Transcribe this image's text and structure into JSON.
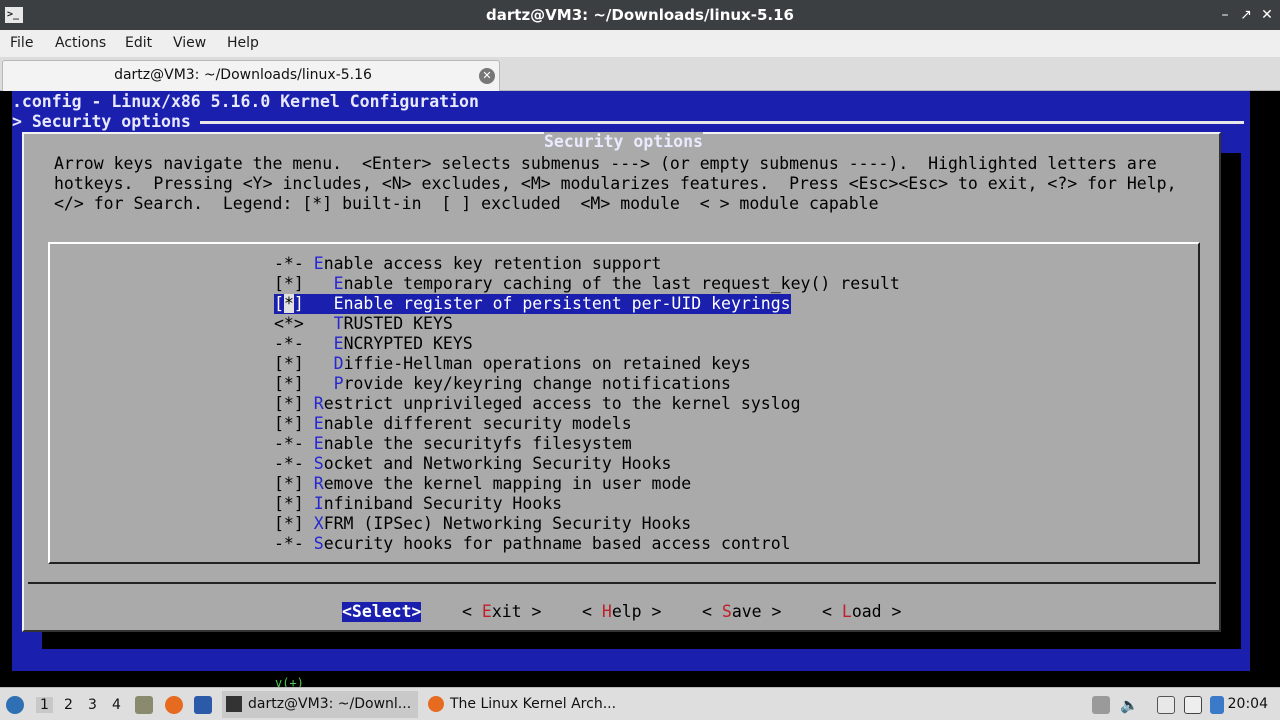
{
  "window": {
    "title": "dartz@VM3: ~/Downloads/linux-5.16",
    "app_icon": ">_"
  },
  "menubar": {
    "items": [
      "File",
      "Actions",
      "Edit",
      "View",
      "Help"
    ]
  },
  "tab": {
    "label": "dartz@VM3: ~/Downloads/linux-5.16"
  },
  "terminal": {
    "header_line1": ".config - Linux/x86 5.16.0 Kernel Configuration",
    "header_line2": "> Security options",
    "dialog_title": "Security options",
    "help_lines": [
      "Arrow keys navigate the menu.  <Enter> selects submenus ---> (or empty submenus ----).  Highlighted letters are",
      "hotkeys.  Pressing <Y> includes, <N> excludes, <M> modularizes features.  Press <Esc><Esc> to exit, <?> for Help,",
      "</> for Search.  Legend: [*] built-in  [ ] excluded  <M> module  < > module capable"
    ],
    "menu_items": [
      {
        "state": "-*-",
        "indent": "",
        "hotkey": "E",
        "rest": "nable access key retention support"
      },
      {
        "state": "[*]",
        "indent": "  ",
        "hotkey": "E",
        "rest": "nable temporary caching of the last request_key() result"
      },
      {
        "state": "[*]",
        "indent": "  ",
        "hotkey": "E",
        "rest": "nable register of persistent per-UID keyrings",
        "selected": true
      },
      {
        "state": "<*>",
        "indent": "  ",
        "hotkey": "T",
        "rest": "RUSTED KEYS"
      },
      {
        "state": "-*-",
        "indent": "  ",
        "hotkey": "E",
        "rest": "NCRYPTED KEYS"
      },
      {
        "state": "[*]",
        "indent": "  ",
        "hotkey": "D",
        "rest": "iffie-Hellman operations on retained keys"
      },
      {
        "state": "[*]",
        "indent": "  ",
        "hotkey": "P",
        "rest": "rovide key/keyring change notifications"
      },
      {
        "state": "[*]",
        "indent": "",
        "hotkey": "R",
        "rest": "estrict unprivileged access to the kernel syslog"
      },
      {
        "state": "[*]",
        "indent": "",
        "hotkey": "E",
        "rest": "nable different security models"
      },
      {
        "state": "-*-",
        "indent": "",
        "hotkey": "E",
        "rest": "nable the securityfs filesystem"
      },
      {
        "state": "-*-",
        "indent": "",
        "hotkey": "S",
        "rest": "ocket and Networking Security Hooks"
      },
      {
        "state": "[*]",
        "indent": "",
        "hotkey": "R",
        "rest": "emove the kernel mapping in user mode"
      },
      {
        "state": "[*]",
        "indent": "",
        "hotkey": "I",
        "rest": "nfiniband Security Hooks"
      },
      {
        "state": "[*]",
        "indent": "",
        "hotkey": "X",
        "rest": "FRM (IPSec) Networking Security Hooks"
      },
      {
        "state": "-*-",
        "indent": "",
        "hotkey": "S",
        "rest": "ecurity hooks for pathname based access control"
      }
    ],
    "more_indicator": "v(+)",
    "buttons": [
      {
        "label": "<Select>"
      },
      {
        "pre": "< ",
        "hotkey": "E",
        "rest": "xit",
        "post": " >"
      },
      {
        "pre": "< ",
        "hotkey": "H",
        "rest": "elp",
        "post": " >"
      },
      {
        "pre": "< ",
        "hotkey": "S",
        "rest": "ave",
        "post": " >"
      },
      {
        "pre": "< ",
        "hotkey": "L",
        "rest": "oad",
        "post": " >"
      }
    ]
  },
  "taskbar": {
    "workspaces": [
      "1",
      "2",
      "3",
      "4"
    ],
    "tasks": [
      "dartz@VM3: ~/Downl...",
      "The Linux Kernel Arch..."
    ],
    "clock": "20:04"
  },
  "colors": {
    "terminal_blue": "#1a20ad",
    "dialog_gray": "#aaaaaa",
    "hotkey_blue": "#2626d2",
    "button_hotkey_red": "#c0202a"
  }
}
